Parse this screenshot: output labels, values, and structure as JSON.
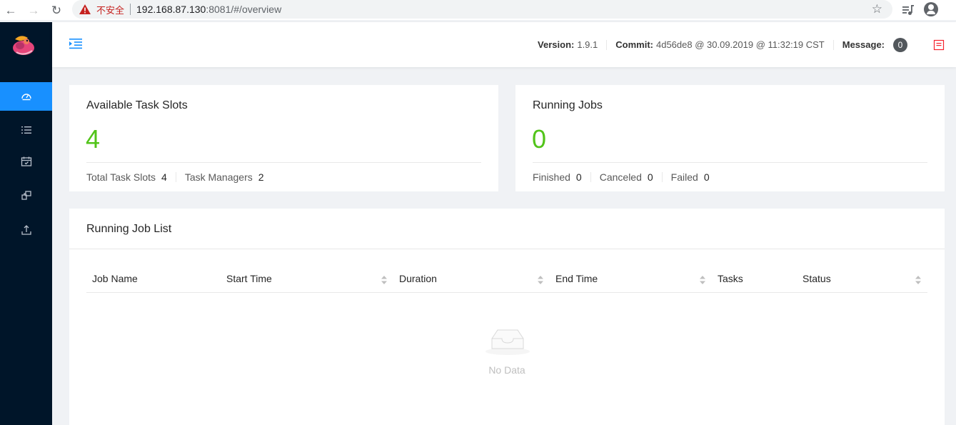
{
  "browser": {
    "insecure_label": "不安全",
    "url_host": "192.168.87.130",
    "url_path": ":8081/#/overview"
  },
  "sidebar": {
    "items": [
      {
        "name": "overview",
        "icon": "dashboard-icon",
        "active": true
      },
      {
        "name": "jobs",
        "icon": "list-icon",
        "active": false
      },
      {
        "name": "task-managers",
        "icon": "schedule-icon",
        "active": false
      },
      {
        "name": "job-manager",
        "icon": "build-icon",
        "active": false
      },
      {
        "name": "submit",
        "icon": "upload-icon",
        "active": false
      }
    ],
    "accent_color": "#1890ff"
  },
  "header": {
    "version_label": "Version:",
    "version_value": "1.9.1",
    "commit_label": "Commit:",
    "commit_value": "4d56de8 @ 30.09.2019 @ 11:32:19 CST",
    "message_label": "Message:",
    "message_count": "0"
  },
  "slots_card": {
    "title": "Available Task Slots",
    "value": "4",
    "total_label": "Total Task Slots",
    "total_value": "4",
    "tm_label": "Task Managers",
    "tm_value": "2"
  },
  "jobs_card": {
    "title": "Running Jobs",
    "value": "0",
    "finished_label": "Finished",
    "finished_value": "0",
    "canceled_label": "Canceled",
    "canceled_value": "0",
    "failed_label": "Failed",
    "failed_value": "0"
  },
  "job_list": {
    "title": "Running Job List",
    "columns": [
      "Job Name",
      "Start Time",
      "Duration",
      "End Time",
      "Tasks",
      "Status"
    ],
    "empty_text": "No Data"
  },
  "colors": {
    "green": "#52c41a",
    "sidebar_bg": "#001529",
    "warning_red": "#c5221f"
  }
}
